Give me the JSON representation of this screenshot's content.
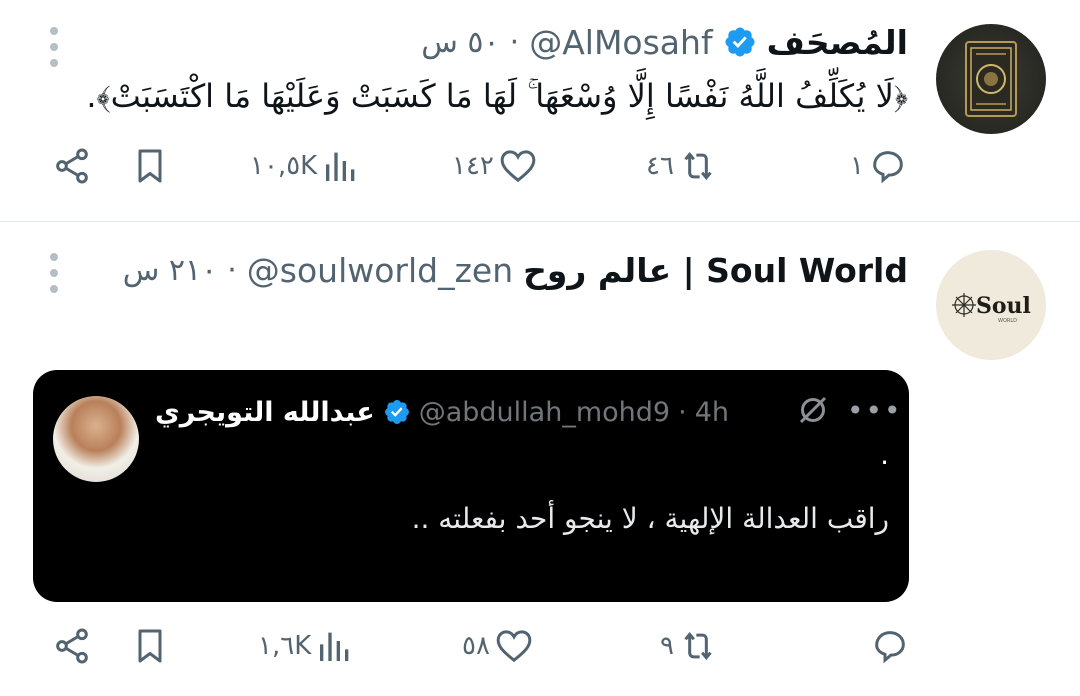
{
  "tweets": [
    {
      "author_name": "المُصحَف",
      "handle": "@AlMosahf",
      "time": "٥٠ س",
      "separator": "·",
      "text": "﴿لَا يُكَلِّفُ اللَّهُ نَفْسًا إِلَّا وُسْعَهَا ۚ لَهَا مَا كَسَبَتْ وَعَلَيْهَا مَا اكْتَسَبَتْ﴾.",
      "stats": {
        "views": "١٠,٥K",
        "likes": "١٤٢",
        "retweets": "٤٦",
        "replies": "١"
      }
    },
    {
      "author_name": "عالم روح | Soul World",
      "handle": "@soulworld_zen",
      "time": "٢١٠ س",
      "separator": "·",
      "avatar_text": "Soul",
      "avatar_subtext": "WORLD",
      "quote": {
        "author_name": "عبدالله التويجري",
        "handle": "@abdullah_mohd9",
        "separator": "·",
        "time": "4h",
        "more": "•••",
        "dot": ".",
        "text": "راقب العدالة الإلهية ، لا ينجو أحد بفعلته .."
      },
      "stats": {
        "views": "١,٦K",
        "likes": "٥٨",
        "retweets": "٩",
        "replies": ""
      }
    }
  ],
  "colors": {
    "verified": "#1d9bf0",
    "secondary_text": "#536471",
    "quote_bg": "#000000"
  },
  "icons": [
    "more-vertical-icon",
    "verified-badge-icon",
    "share-icon",
    "bookmark-icon",
    "views-icon",
    "like-icon",
    "retweet-icon",
    "reply-icon",
    "grok-icon",
    "more-horizontal-icon"
  ]
}
